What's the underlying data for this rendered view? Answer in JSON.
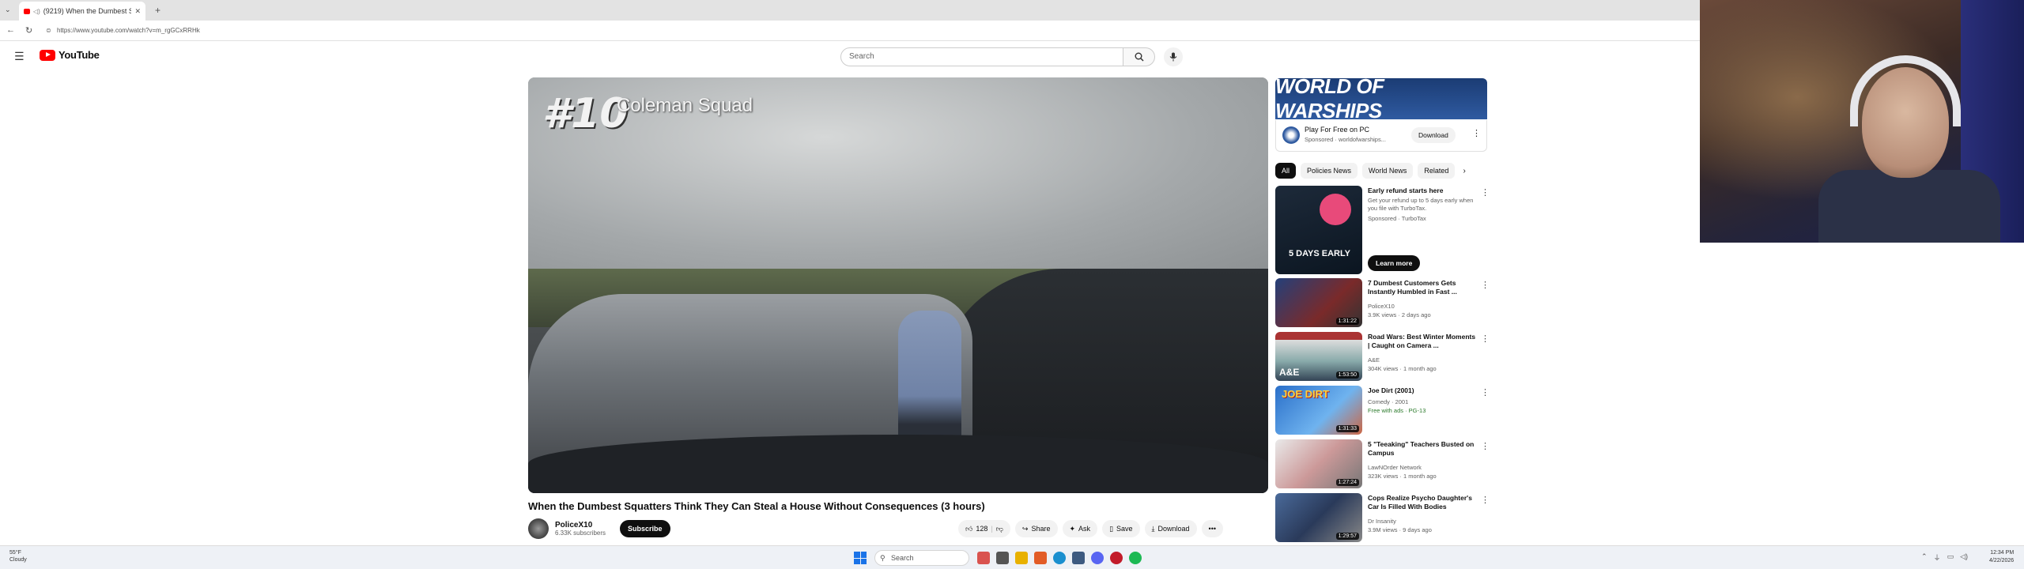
{
  "browser": {
    "tab_title": "(9219) When the Dumbest Sq...",
    "url": "https://www.youtube.com/watch?v=m_rgGCxRRHk"
  },
  "header": {
    "logo_text": "YouTube",
    "search_placeholder": "Search"
  },
  "video": {
    "overlay_number": "#10",
    "overlay_name": "Coleman Squad",
    "title": "When the Dumbest Squatters Think They Can Steal a House Without Consequences (3 hours)",
    "channel": "PoliceX10",
    "subscribers": "6.33K subscribers",
    "subscribe_label": "Subscribe",
    "likes": "128",
    "share_label": "Share",
    "ask_label": "Ask",
    "save_label": "Save",
    "download_label": "Download"
  },
  "ad": {
    "banner_text": "WORLD OF WARSHIPS",
    "headline": "Play For Free on PC",
    "sponsor": "Sponsored · worldofwarships...",
    "download_label": "Download"
  },
  "chips": [
    "All",
    "Policies News",
    "World News",
    "Related"
  ],
  "recommendations": [
    {
      "title": "Early refund starts here",
      "line1": "Get your refund up to 5 days early when you file with TurboTax.",
      "line2": "Sponsored · TurboTax",
      "duration": "",
      "thumb_text": "5 DAYS EARLY",
      "cta": "Learn more"
    },
    {
      "title": "7 Dumbest Customers Gets Instantly Humbled in Fast ...",
      "line1": "PoliceX10",
      "line2": "3.9K views · 2 days ago",
      "duration": "1:31:22",
      "thumb_text": ""
    },
    {
      "title": "Road Wars: Best Winter Moments | Caught on Camera ...",
      "line1": "A&E",
      "line2": "304K views · 1 month ago",
      "duration": "1:53:50",
      "thumb_text": "A&E"
    },
    {
      "title": "Joe Dirt (2001)",
      "line1": "Comedy · 2001",
      "line2": "Free with ads · PG-13",
      "duration": "1:31:33",
      "thumb_text": "JOE DIRT"
    },
    {
      "title": "5 \"Teeaking\" Teachers Busted on Campus",
      "line1": "LawNOrder Network",
      "line2": "323K views · 1 month ago",
      "duration": "1:27:24",
      "thumb_text": ""
    },
    {
      "title": "Cops Realize Psycho Daughter's Car Is Filled With Bodies",
      "line1": "Dr Insanity",
      "line2": "3.9M views · 9 days ago",
      "duration": "1:29:57",
      "thumb_text": ""
    }
  ],
  "taskbar": {
    "weather_temp": "55°F",
    "weather_desc": "Cloudy",
    "search_label": "Search",
    "time": "12:34 PM",
    "date": "4/22/2026"
  },
  "colors": {
    "youtube_red": "#ff0000",
    "subscribe_bg": "#0f0f0f",
    "ad_blue": "#1b3c74"
  }
}
